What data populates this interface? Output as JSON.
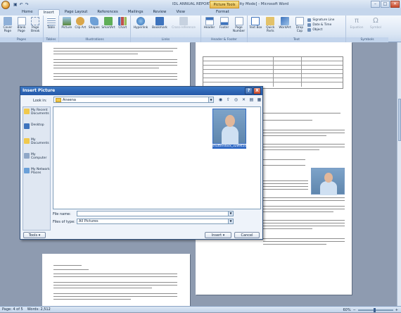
{
  "window": {
    "title": "IDL ANNUAL REPORT 10 [Compatibility Mode] - Microsoft Word",
    "context_tab": "Picture Tools"
  },
  "ribbon": {
    "tabs": [
      "Home",
      "Insert",
      "Page Layout",
      "References",
      "Mailings",
      "Review",
      "View"
    ],
    "active_tab": "Insert",
    "format_tab": "Format",
    "groups": {
      "pages": {
        "label": "Pages",
        "buttons": [
          "Cover Page",
          "Blank Page",
          "Page Break"
        ]
      },
      "tables": {
        "label": "Tables",
        "buttons": [
          "Table"
        ]
      },
      "illustrations": {
        "label": "Illustrations",
        "buttons": [
          "Picture",
          "Clip Art",
          "Shapes",
          "SmartArt",
          "Chart"
        ]
      },
      "links": {
        "label": "Links",
        "buttons": [
          "Hyperlink",
          "Bookmark",
          "Cross-reference"
        ]
      },
      "header_footer": {
        "label": "Header & Footer",
        "buttons": [
          "Header",
          "Footer",
          "Page Number"
        ]
      },
      "text": {
        "label": "Text",
        "buttons": [
          "Text Box",
          "Quick Parts",
          "WordArt",
          "Drop Cap"
        ],
        "small": [
          "Signature Line",
          "Date & Time",
          "Object"
        ]
      },
      "symbols": {
        "label": "Symbols",
        "buttons": [
          "Equation",
          "Symbol"
        ]
      }
    }
  },
  "dialog": {
    "title": "Insert Picture",
    "look_in_label": "Look in:",
    "look_in_value": "Aneena",
    "places": [
      "My Recent Documents",
      "Desktop",
      "My Documents",
      "My Computer",
      "My Network Places"
    ],
    "files": [
      {
        "name": "shutterstock_32894509"
      }
    ],
    "file_name_label": "File name:",
    "file_name_value": "",
    "files_of_type_label": "Files of type:",
    "files_of_type_value": "All Pictures",
    "tools_label": "Tools",
    "insert_label": "Insert",
    "cancel_label": "Cancel",
    "help_glyph": "?",
    "close_glyph": "X"
  },
  "status": {
    "page": "Page: 4 of 5",
    "words": "Words: 2,512",
    "zoom": "60%"
  },
  "icons": {
    "accent": "#2458a8",
    "folder": "#f0c94d"
  }
}
